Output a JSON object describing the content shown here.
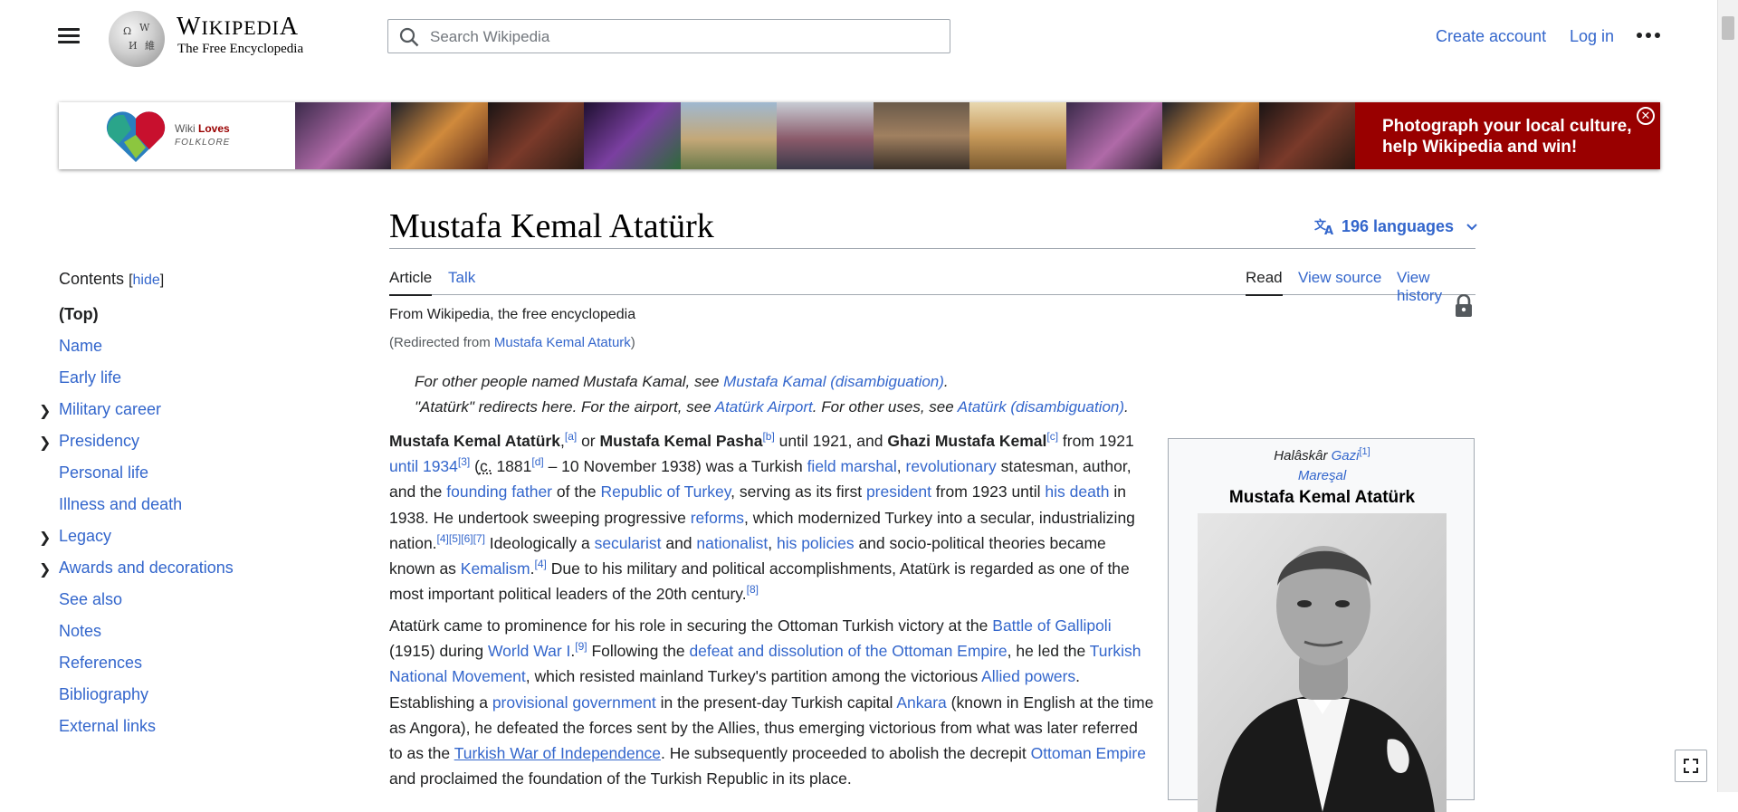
{
  "header": {
    "wordmark_big1": "W",
    "wordmark_rest": "IKIPEDI",
    "wordmark_big2": "A",
    "tagline": "The Free Encyclopedia",
    "search_placeholder": "Search Wikipedia",
    "create_account": "Create account",
    "log_in": "Log in"
  },
  "banner": {
    "wlf_wiki": "Wiki",
    "wlf_loves": "Loves",
    "wlf_folklore": "FOLKLORE",
    "cta": "Photograph your local culture, help Wikipedia and win!",
    "close_glyph": "✕",
    "accent": "#990000"
  },
  "toc": {
    "title": "Contents",
    "hide_open": "[",
    "hide": "hide",
    "hide_close": "]",
    "items": [
      {
        "label": "(Top)"
      },
      {
        "label": "Name"
      },
      {
        "label": "Early life"
      },
      {
        "label": "Military career",
        "expandable": true
      },
      {
        "label": "Presidency",
        "expandable": true
      },
      {
        "label": "Personal life"
      },
      {
        "label": "Illness and death"
      },
      {
        "label": "Legacy",
        "expandable": true
      },
      {
        "label": "Awards and decorations",
        "expandable": true
      },
      {
        "label": "See also"
      },
      {
        "label": "Notes"
      },
      {
        "label": "References"
      },
      {
        "label": "Bibliography"
      },
      {
        "label": "External links"
      }
    ]
  },
  "article": {
    "title": "Mustafa Kemal Atatürk",
    "languages": "196 languages",
    "tabs": {
      "article": "Article",
      "talk": "Talk",
      "read": "Read",
      "view_source": "View source",
      "view_history": "View history"
    },
    "from": "From Wikipedia, the free encyclopedia",
    "redirect_prefix": "(Redirected from ",
    "redirect_link": "Mustafa Kemal Ataturk",
    "redirect_suffix": ")",
    "hatnote1": {
      "pre": "For other people named Mustafa Kamal, see ",
      "link": "Mustafa Kamal (disambiguation)",
      "post": "."
    },
    "hatnote2": {
      "pre": "\"Atatürk\" redirects here. For the airport, see ",
      "link1": "Atatürk Airport",
      "mid": ". For other uses, see ",
      "link2": "Atatürk (disambiguation)",
      "post": "."
    }
  },
  "infobox": {
    "honorific": "Halâskâr ",
    "honorific_link": "Gazi",
    "honorific_ref": "[1]",
    "rank": "Mareşal",
    "name": "Mustafa Kemal Atatürk"
  }
}
